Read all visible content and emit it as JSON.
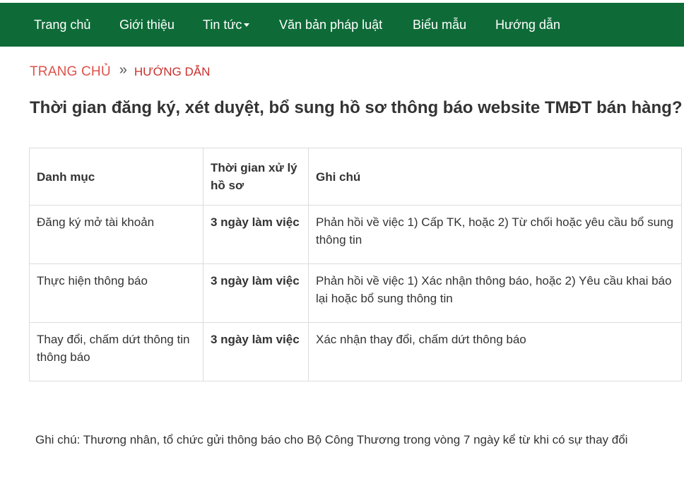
{
  "nav": {
    "items": [
      {
        "label": "Trang chủ"
      },
      {
        "label": "Giới thiệu"
      },
      {
        "label": "Tin tức"
      },
      {
        "label": "Văn bản pháp luật"
      },
      {
        "label": "Biểu mẫu"
      },
      {
        "label": "Hướng dẫn"
      }
    ],
    "background_color": "#0e6b38"
  },
  "breadcrumb": {
    "home": "TRANG CHỦ",
    "separator": "»",
    "current": "HƯỚNG DẪN",
    "home_color": "#e0514a"
  },
  "page_title": "Thời gian đăng ký, xét duyệt, bổ sung hồ sơ thông báo website TMĐT bán hàng?",
  "table": {
    "headers": [
      "Danh mục",
      "Thời gian xử lý hồ sơ",
      "Ghi chú"
    ],
    "rows": [
      [
        "Đăng ký mở tài khoản",
        "3 ngày làm việc",
        "Phản hồi về việc 1) Cấp TK, hoặc 2) Từ chối hoặc yêu cầu bổ sung thông tin"
      ],
      [
        "Thực hiện thông báo",
        "3 ngày làm việc",
        "Phản hồi về việc 1) Xác nhận thông báo, hoặc 2) Yêu cầu khai báo lại hoặc bổ sung thông tin"
      ],
      [
        "Thay đổi, chấm dứt thông tin thông báo",
        "3 ngày làm việc",
        "Xác nhận thay đổi, chấm dứt thông báo"
      ]
    ]
  },
  "note": "Ghi chú: Thương nhân, tổ chức gửi thông báo cho Bộ Công Thương trong vòng 7 ngày kể từ khi có sự thay đổi"
}
